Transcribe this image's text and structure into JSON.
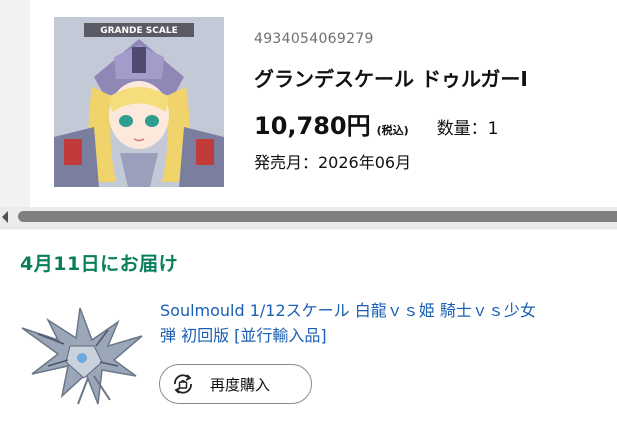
{
  "product": {
    "image_badge": "GRANDE SCALE",
    "jan": "4934054069279",
    "title": "グランデスケール ドゥルガーI",
    "price": "10,780円",
    "tax_note": "(税込)",
    "quantity": "数量：1",
    "release": "発売月：2026年06月"
  },
  "delivery": {
    "title": "4月11日にお届け",
    "item": {
      "line1": "Soulmould 1/12スケール 白龍ｖｓ姫 騎士ｖｓ少女",
      "line2": "弾 初回版 [並行輸入品]"
    },
    "rebuy_label": "再度購入"
  },
  "colors": {
    "delivery_title": "#087f5b",
    "link": "#1a5fb4"
  }
}
